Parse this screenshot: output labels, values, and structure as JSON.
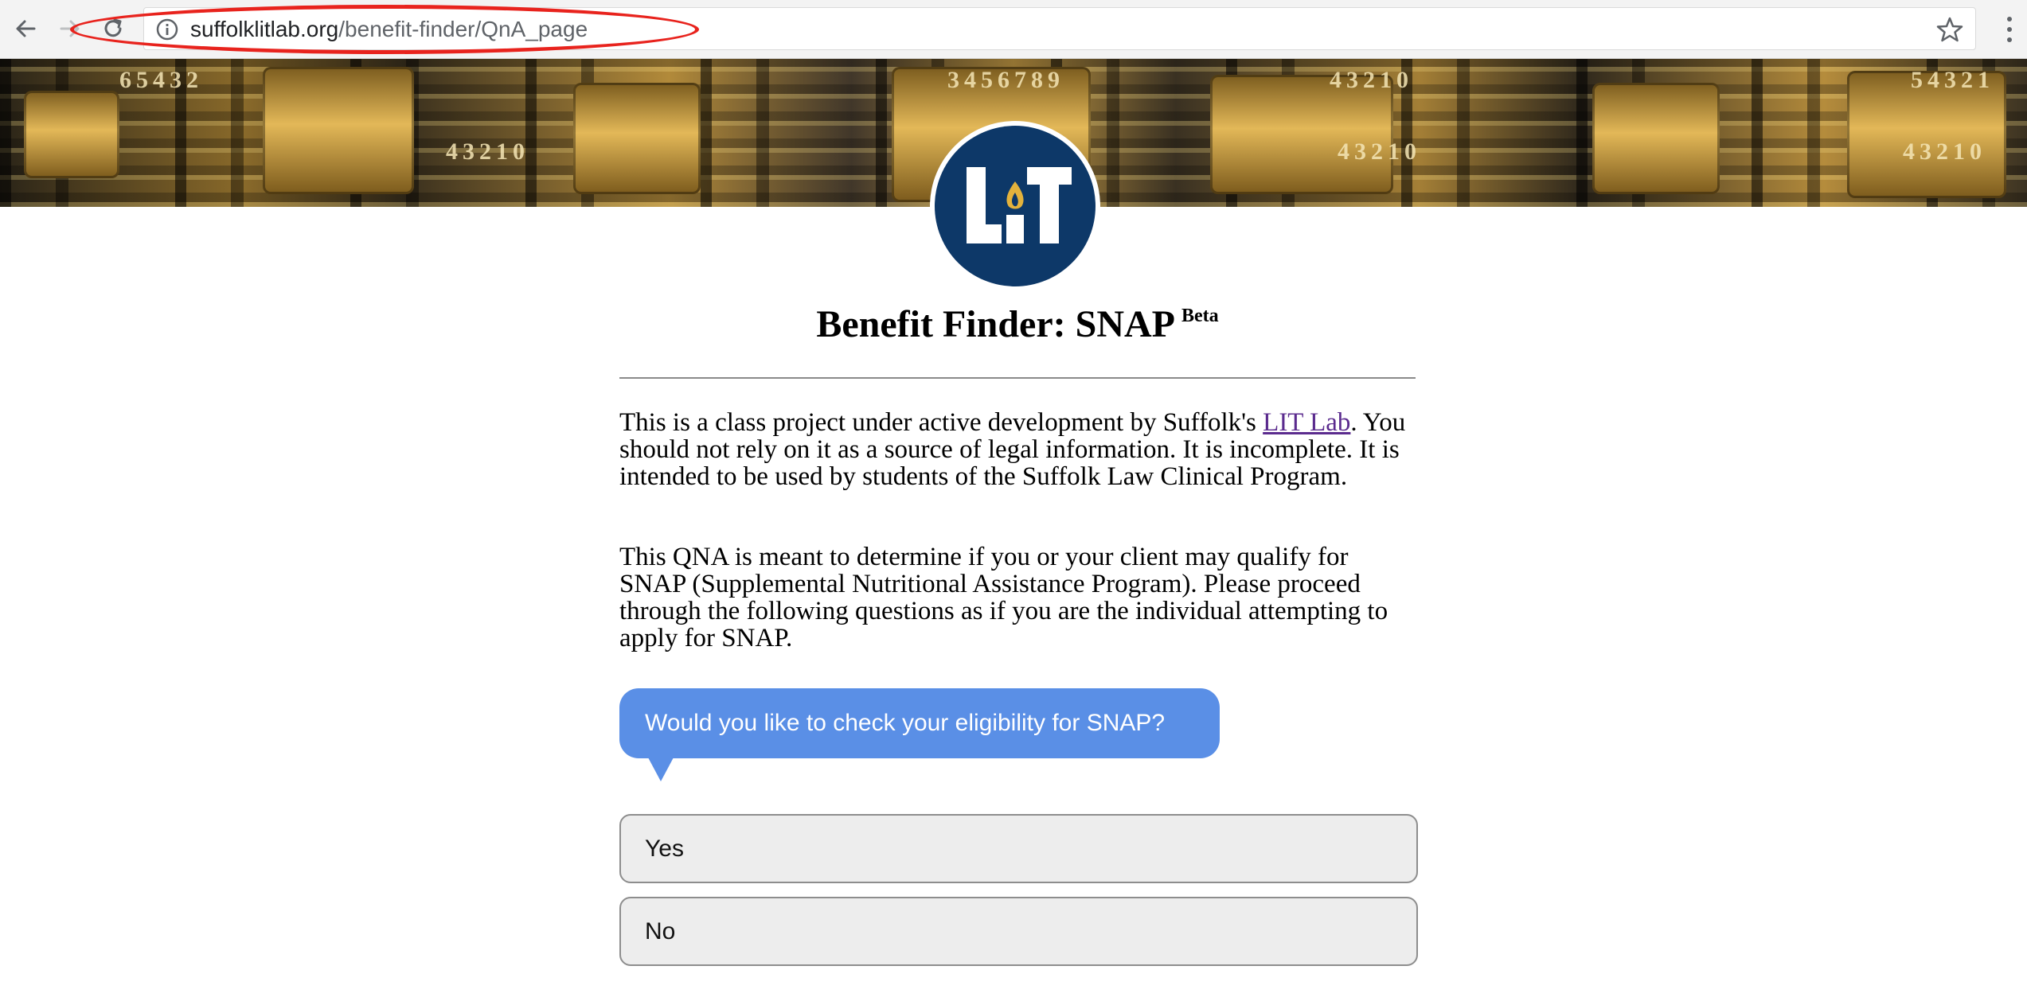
{
  "browser": {
    "url_host": "suffolklitlab.org",
    "url_path": "/benefit-finder/QnA_page"
  },
  "header": {
    "banner_digits": [
      "65432",
      "43210",
      "3456789",
      "43210",
      "54321",
      "43210",
      "43210"
    ],
    "logo_text": "LIT"
  },
  "main": {
    "title": "Benefit Finder: SNAP",
    "beta_label": "Beta",
    "intro_before_link": "This is a class project under active development by Suffolk's ",
    "intro_link": "LIT Lab",
    "intro_after_link": ". You should not rely on it as a source of legal information. It is incomplete. It is intended to be used by students of the Suffolk Law Clinical Program.",
    "description": "This QNA is meant to determine if you or your client may qualify for SNAP (Supplemental Nutritional Assistance Program). Please proceed through the following questions as if you are the individual attempting to apply for SNAP.",
    "question": "Would you like to check your eligibility for SNAP?",
    "answers": [
      "Yes",
      "No"
    ]
  },
  "colors": {
    "bubble": "#5a8fe6",
    "logo_navy": "#0d3868",
    "annotation_red": "#e8231d",
    "link": "#5b2b8e"
  }
}
